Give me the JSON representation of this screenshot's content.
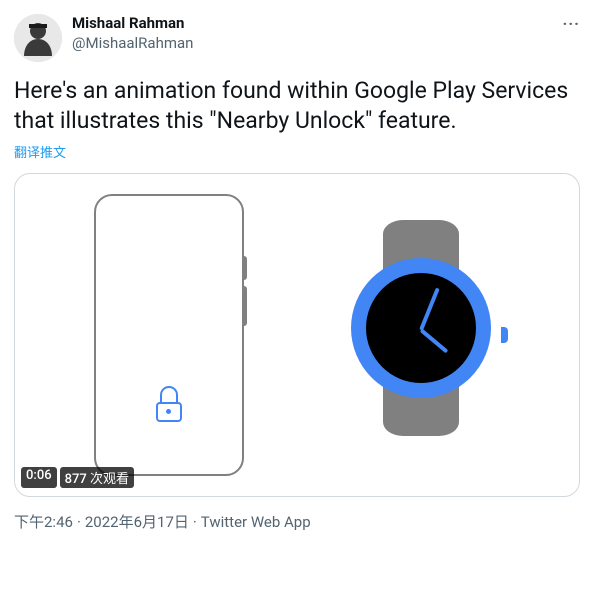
{
  "author": {
    "display_name": "Mishaal Rahman",
    "handle": "@MishaalRahman"
  },
  "tweet_text": "Here's an animation found within Google Play Services that illustrates this \"Nearby Unlock\" feature.",
  "translate_label": "翻译推文",
  "video": {
    "duration": "0:06",
    "views_label": "877 次观看"
  },
  "timestamp": {
    "time": "下午2:46",
    "date": "2022年6月17日",
    "source": "Twitter Web App"
  },
  "more_label": "···"
}
